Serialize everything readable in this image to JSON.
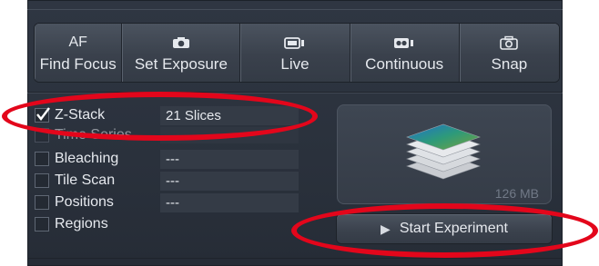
{
  "toolbar": {
    "buttons": [
      {
        "top_text": "AF",
        "label": "Find Focus",
        "icon": "af-text"
      },
      {
        "top_text": "",
        "label": "Set Exposure",
        "icon": "camera-icon"
      },
      {
        "top_text": "",
        "label": "Live",
        "icon": "video-camera-icon"
      },
      {
        "top_text": "",
        "label": "Continuous",
        "icon": "video-camera-icon"
      },
      {
        "top_text": "",
        "label": "Snap",
        "icon": "camera-outline-icon"
      }
    ]
  },
  "options": [
    {
      "label": "Z-Stack",
      "value": "21 Slices",
      "checked": true
    },
    {
      "label": "Time Series",
      "value": "",
      "checked": false
    },
    {
      "label": "Bleaching",
      "value": "---",
      "checked": false
    },
    {
      "label": "Tile Scan",
      "value": "---",
      "checked": false
    },
    {
      "label": "Positions",
      "value": "---",
      "checked": false
    },
    {
      "label": "Regions",
      "value": "",
      "checked": false
    }
  ],
  "preview": {
    "size_text": "126 MB",
    "icon": "stack-layers-icon"
  },
  "start": {
    "label": "Start Experiment",
    "icon": "play-icon"
  },
  "colors": {
    "panel": "#2f3642",
    "text": "#e6e9ee",
    "highlight": "#e3061b"
  }
}
